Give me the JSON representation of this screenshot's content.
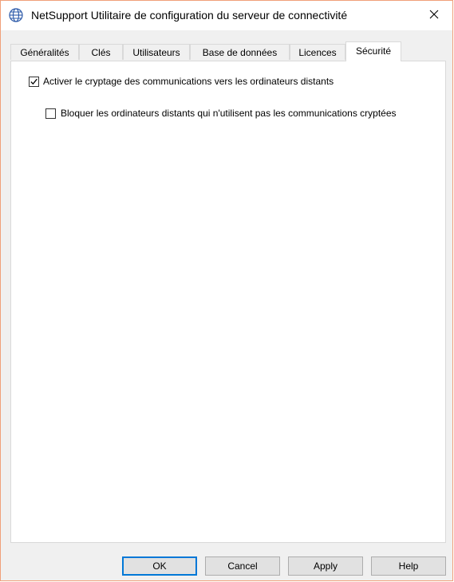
{
  "window": {
    "title": "NetSupport Utilitaire de configuration du serveur de connectivité"
  },
  "tabs": [
    {
      "label": "Généralités"
    },
    {
      "label": "Clés"
    },
    {
      "label": "Utilisateurs"
    },
    {
      "label": "Base de données"
    },
    {
      "label": "Licences"
    },
    {
      "label": "Sécurité",
      "active": true
    }
  ],
  "security": {
    "encrypt_label": "Activer le cryptage des communications vers les ordinateurs distants",
    "encrypt_checked": true,
    "block_label": "Bloquer les ordinateurs distants qui n'utilisent pas les communications cryptées",
    "block_checked": false
  },
  "buttons": {
    "ok": "OK",
    "cancel": "Cancel",
    "apply": "Apply",
    "help": "Help"
  },
  "colors": {
    "window_border": "#f0a079",
    "app_icon": "#2a58a8",
    "default_button_border": "#0078d7"
  },
  "icons": {
    "app": "globe-icon",
    "close": "close-icon",
    "check": "checkmark-icon"
  }
}
